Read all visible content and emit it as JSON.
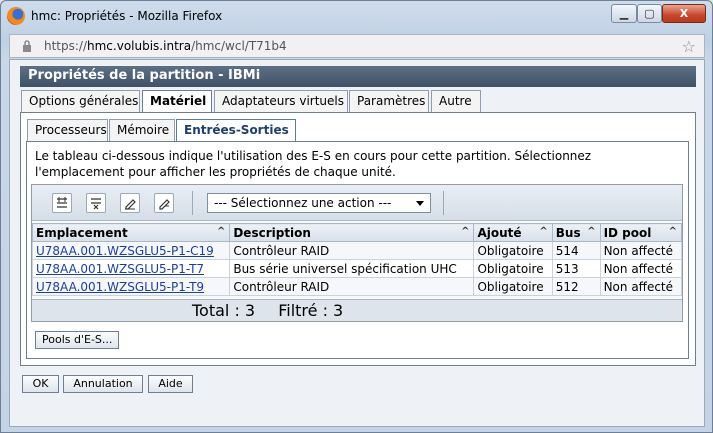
{
  "window": {
    "title": "hmc: Propriétés - Mozilla Firefox",
    "controls": {
      "minimize": "▁",
      "maximize": "▢",
      "close": "X"
    }
  },
  "urlbar": {
    "scheme": "https://",
    "host": "hmc.volubis.intra",
    "path": "/hmc/wcl/T71b4"
  },
  "panel": {
    "title": "Propriétés de la partition - IBMi",
    "tabs": [
      {
        "label": "Options générales"
      },
      {
        "label": "Matériel"
      },
      {
        "label": "Adaptateurs virtuels"
      },
      {
        "label": "Paramètres"
      },
      {
        "label": "Autre"
      }
    ],
    "subtabs": [
      {
        "label": "Processeurs"
      },
      {
        "label": "Mémoire"
      },
      {
        "label": "Entrées-Sorties"
      }
    ],
    "description_line1": "Le tableau ci-dessous indique l'utilisation des E-S en cours pour cette partition. Sélectionnez",
    "description_line2": "l'emplacement pour afficher les propriétés de chaque unité.",
    "action_select": "--- Sélectionnez une action ---",
    "table": {
      "columns": [
        "Emplacement",
        "Description",
        "Ajouté",
        "Bus",
        "ID pool"
      ],
      "rows": [
        [
          "U78AA.001.WZSGLU5-P1-C19",
          "Contrôleur RAID",
          "Obligatoire",
          "514",
          "Non affecté"
        ],
        [
          "U78AA.001.WZSGLU5-P1-T7",
          "Bus série universel spécification UHC",
          "Obligatoire",
          "513",
          "Non affecté"
        ],
        [
          "U78AA.001.WZSGLU5-P1-T9",
          "Contrôleur RAID",
          "Obligatoire",
          "512",
          "Non affecté"
        ]
      ],
      "total_label": "Total : 3",
      "filtered_label": "Filtré : 3"
    },
    "pools_button": "Pools d'E-S...",
    "buttons": {
      "ok": "OK",
      "cancel": "Annulation",
      "help": "Aide"
    }
  }
}
